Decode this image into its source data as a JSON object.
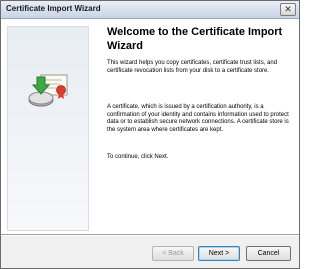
{
  "window": {
    "title": "Certificate Import Wizard",
    "close_glyph": "✕"
  },
  "content": {
    "heading": "Welcome to the Certificate Import Wizard",
    "paragraphs": [
      "This wizard helps you copy certificates, certificate trust lists, and certificate revocation lists from your disk to a certificate store.",
      "A certificate, which is issued by a certification authority, is a confirmation of your identity and contains information used to protect data or to establish secure network connections. A certificate store is the system area where certificates are kept.",
      "To continue, click Next."
    ]
  },
  "buttons": {
    "back": "< Back",
    "next": "Next >",
    "cancel": "Cancel"
  },
  "colors": {
    "title_bar": "#c9d4e6",
    "default_button_border": "#3c7fb1",
    "arrow_green": "#3ea843"
  }
}
